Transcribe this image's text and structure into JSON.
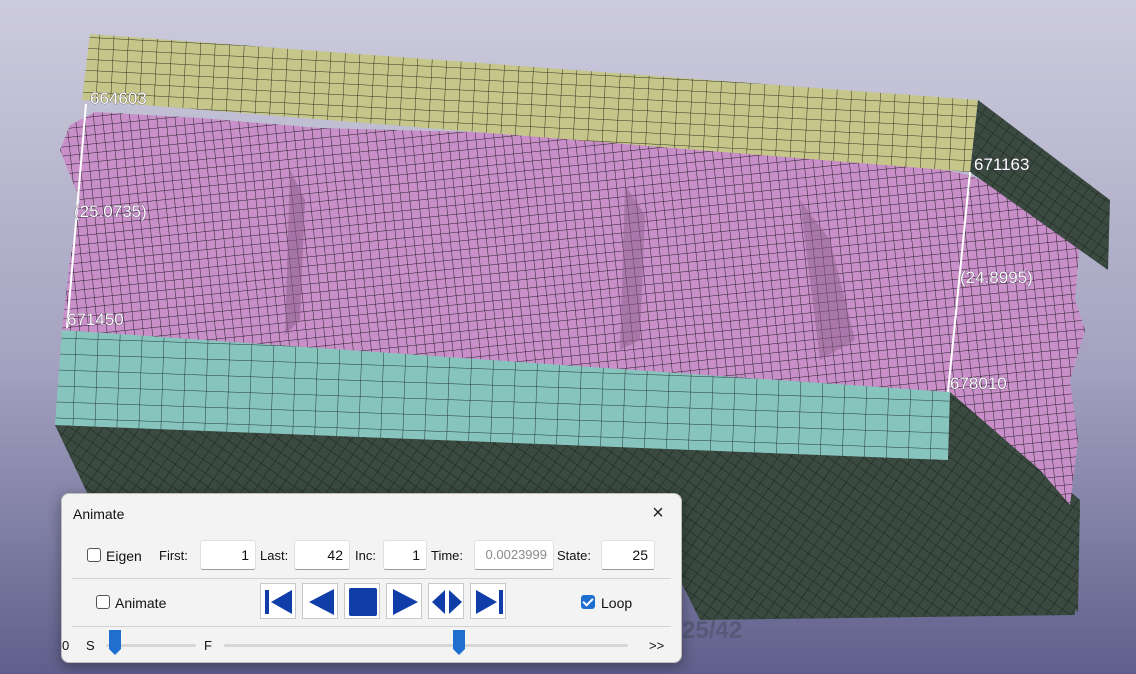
{
  "viewport": {
    "node_labels": [
      "664603",
      "671163",
      "671450",
      "678010"
    ],
    "distance_labels": [
      "(25.0735)",
      "(24.8995)"
    ],
    "state_counter": "25/42",
    "colors": {
      "background_top": "#c7c7da",
      "background_bottom": "#6a6a92",
      "top_plate": "#c6c68a",
      "bottom_plate": "#88c4be",
      "plate_side_dark": "#2d3b33",
      "crushed_core": "#c98fc9",
      "mesh_lines": "#2a1f2a"
    }
  },
  "animate_dialog": {
    "title": "Animate",
    "close_icon": "×",
    "eigen_label": "Eigen",
    "eigen_checked": false,
    "first_label": "First:",
    "first_value": "1",
    "last_label": "Last:",
    "last_value": "42",
    "inc_label": "Inc:",
    "inc_value": "1",
    "time_label": "Time:",
    "time_value": "0.0023999",
    "state_label": "State:",
    "state_value": "25",
    "animate_label": "Animate",
    "animate_checked": false,
    "loop_label": "Loop",
    "loop_checked": true,
    "playback_buttons": [
      "first-frame-icon",
      "play-backward-icon",
      "stop-icon",
      "play-forward-icon",
      "bounce-icon",
      "last-frame-icon"
    ],
    "slider": {
      "left_label": "0",
      "s_label": "S",
      "f_label": "F",
      "end_label": ">>",
      "s_position_fraction": 0.0,
      "f_position_fraction": 0.57
    },
    "accent_color": "#1f6fd1"
  }
}
